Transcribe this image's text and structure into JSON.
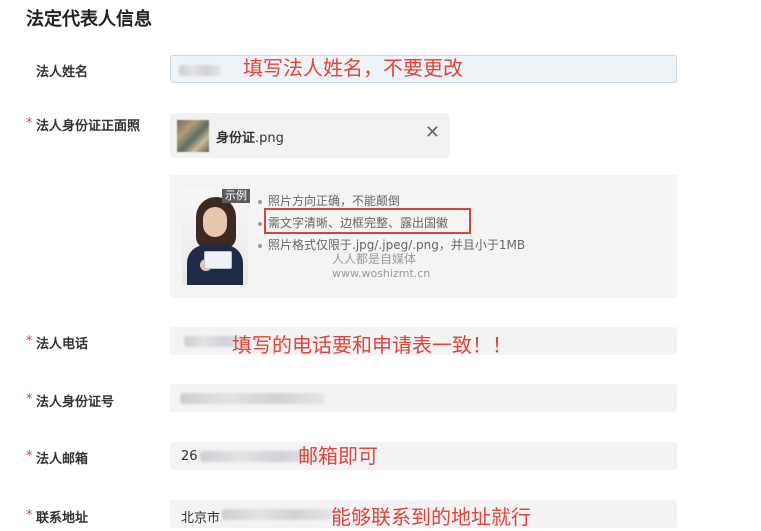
{
  "section_title": "法定代表人信息",
  "fields": {
    "legal_name": {
      "label": "法人姓名",
      "annotation": "填写法人姓名，不要更改"
    },
    "id_photo": {
      "label": "法人身份证正面照",
      "file_name_bold": "身份证",
      "file_ext": ".png",
      "example_tag": "示例",
      "tips": [
        "照片方向正确，不能颠倒",
        "需文字清晰、边框完整、露出国徽",
        "照片格式仅限于.jpg/.jpeg/.png，并且小于1MB"
      ],
      "watermark_line1": "人人都是自媒体",
      "watermark_line2": "www.woshizmt.cn"
    },
    "phone": {
      "label": "法人电话",
      "annotation": "填写的电话要和申请表一致！！"
    },
    "id_number": {
      "label": "法人身份证号"
    },
    "email": {
      "label": "法人邮箱",
      "value_prefix": "26",
      "annotation": "邮箱即可"
    },
    "address": {
      "label": "联系地址",
      "value_prefix": "北京市",
      "annotation": "能够联系到的地址就行"
    }
  },
  "required_mark": "*",
  "icons": {
    "close": "close-icon"
  }
}
